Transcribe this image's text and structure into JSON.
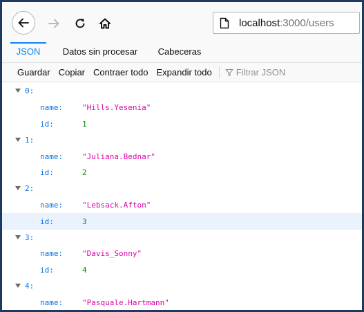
{
  "browser": {
    "url_host": "localhost",
    "url_rest": ":3000/users"
  },
  "tabs": [
    {
      "label": "JSON",
      "active": true
    },
    {
      "label": "Datos sin procesar",
      "active": false
    },
    {
      "label": "Cabeceras",
      "active": false
    }
  ],
  "actions": {
    "save": "Guardar",
    "copy": "Copiar",
    "collapse": "Contraer todo",
    "expand": "Expandir todo",
    "filter_placeholder": "Filtrar JSON"
  },
  "colors": {
    "key": "#0074e8",
    "string": "#dd00a9",
    "number": "#058b00",
    "accent": "#0a84ff",
    "frame_border": "#1f3a5f"
  },
  "json_items": [
    {
      "index": "0:",
      "name_key": "name:",
      "name": "\"Hills.Yesenia\"",
      "id_key": "id:",
      "id": "1"
    },
    {
      "index": "1:",
      "name_key": "name:",
      "name": "\"Juliana.Bednar\"",
      "id_key": "id:",
      "id": "2"
    },
    {
      "index": "2:",
      "name_key": "name:",
      "name": "\"Lebsack.Afton\"",
      "id_key": "id:",
      "id": "3"
    },
    {
      "index": "3:",
      "name_key": "name:",
      "name": "\"Davis_Sonny\"",
      "id_key": "id:",
      "id": "4"
    },
    {
      "index": "4:",
      "name_key": "name:",
      "name": "\"Pasquale.Hartmann\""
    }
  ],
  "selected_row": "id of item 2"
}
